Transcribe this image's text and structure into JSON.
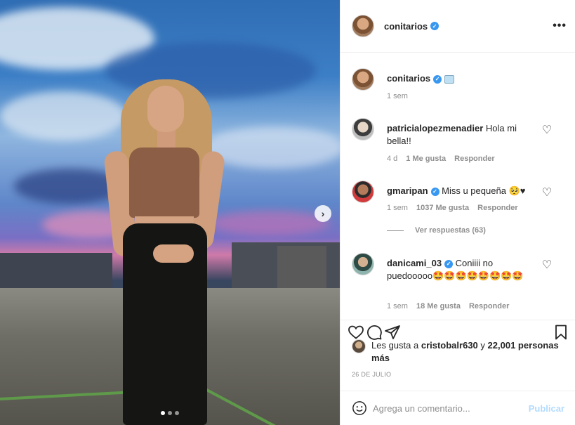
{
  "post": {
    "author": "conitarios",
    "carousel": {
      "total": 3,
      "active": 1
    },
    "caption_emoji": "ice-cube",
    "caption_time": "1 sem",
    "likes_prefix": "Les gusta a",
    "likes_user": "cristobalr630",
    "likes_and": "y",
    "likes_count": "22,001 personas más",
    "date": "26 DE JULIO"
  },
  "comments": [
    {
      "user": "patricialopezmenadier",
      "verified": false,
      "text": "Hola mi bella!!",
      "time": "4 d",
      "likes": "1 Me gusta",
      "reply": "Responder"
    },
    {
      "user": "gmaripan",
      "verified": true,
      "text": "Miss u pequeña 🥺♥",
      "time": "1 sem",
      "likes": "1037 Me gusta",
      "reply": "Responder",
      "view_replies": "Ver respuestas (63)"
    },
    {
      "user": "danicami_03",
      "verified": true,
      "text": "Coniiii no puedooooo🤩🤩🤩🤩🤩🤩🤩🤩",
      "time": "1 sem",
      "likes": "18 Me gusta",
      "reply": "Responder"
    }
  ],
  "add_comment": {
    "placeholder": "Agrega un comentario...",
    "publish": "Publicar"
  },
  "icons": {
    "verified": "✓",
    "more": "•••",
    "next": "›",
    "heart": "♡"
  },
  "colors": {
    "verified": "#3897f0",
    "publish_disabled": "#b3dbff",
    "secondary_text": "#8e8e8e"
  }
}
